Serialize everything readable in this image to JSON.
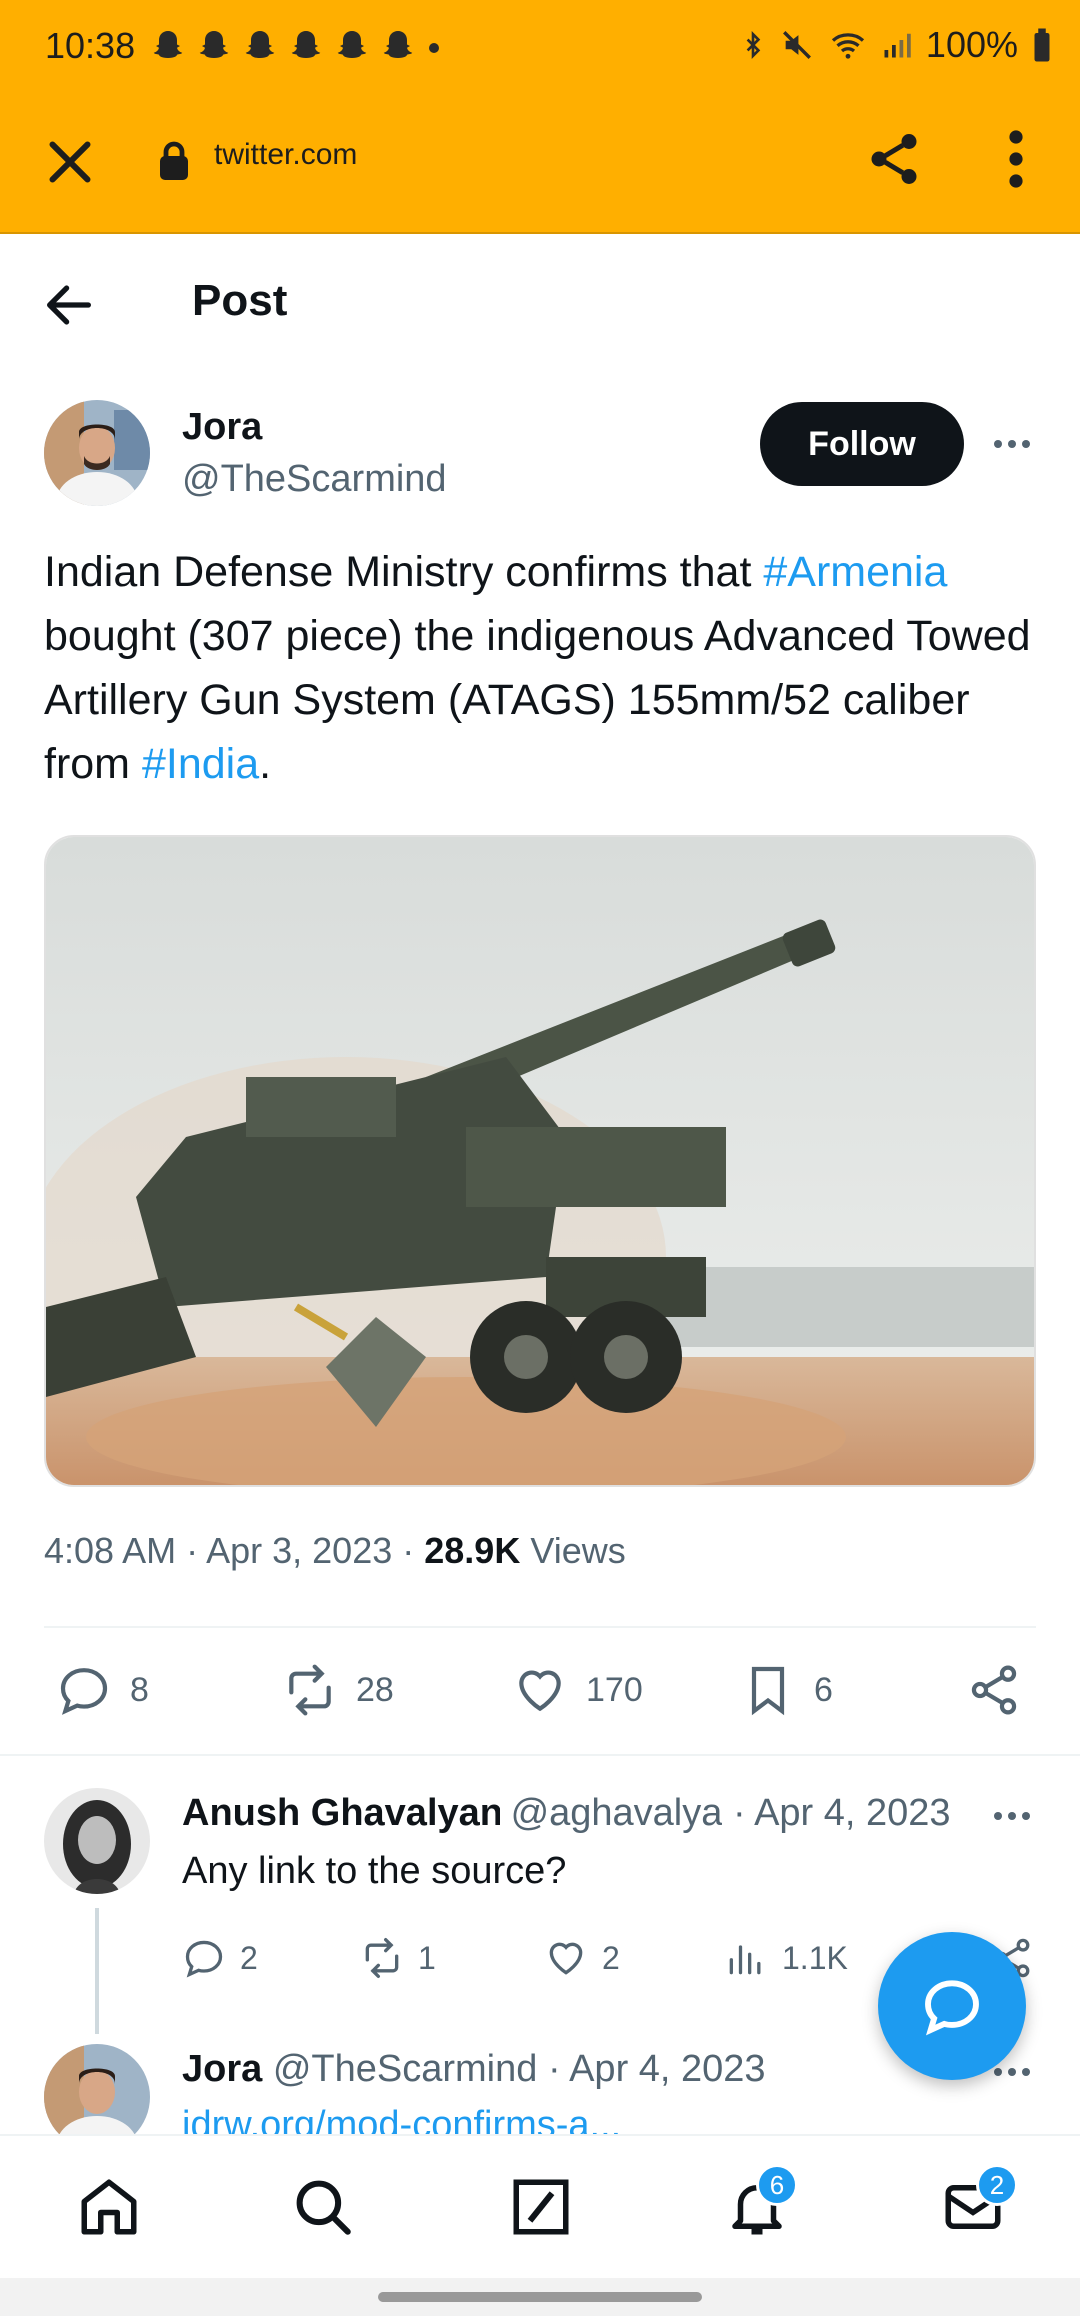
{
  "status_bar": {
    "time": "10:38",
    "battery": "100%"
  },
  "browser": {
    "url": "twitter.com"
  },
  "header": {
    "title": "Post"
  },
  "tweet": {
    "name": "Jora",
    "handle": "@TheScarmind",
    "follow_label": "Follow",
    "text_part1": "Indian Defense Ministry confirms that ",
    "hashtag1": "#Armenia",
    "text_part2": " bought (307 piece) the indigenous Advanced Towed Artillery Gun System (ATAGS) 155mm/52 caliber from ",
    "hashtag2": "#India",
    "text_part3": ".",
    "time": "4:08 AM",
    "date": "Apr 3, 2023",
    "views_count": "28.9K",
    "views_label": "Views",
    "replies": "8",
    "retweets": "28",
    "likes": "170",
    "bookmarks": "6"
  },
  "replies": [
    {
      "name": "Anush Ghavalyan",
      "handle": "@aghavalya",
      "date": "· Apr 4, 2023",
      "text": "Any link to the source?",
      "replies": "2",
      "retweets": "1",
      "likes": "2",
      "views": "1.1K"
    },
    {
      "name": "Jora",
      "handle": "@TheScarmind",
      "date": "· Apr 4, 2023",
      "text": "idrw.org/mod-confirms-a..."
    }
  ],
  "bottom_nav": {
    "notifications_badge": "6",
    "messages_badge": "2"
  },
  "colors": {
    "accent": "#1d9bf0",
    "browser_bar": "#ffaf00",
    "text": "#0f1419",
    "muted": "#536471"
  }
}
